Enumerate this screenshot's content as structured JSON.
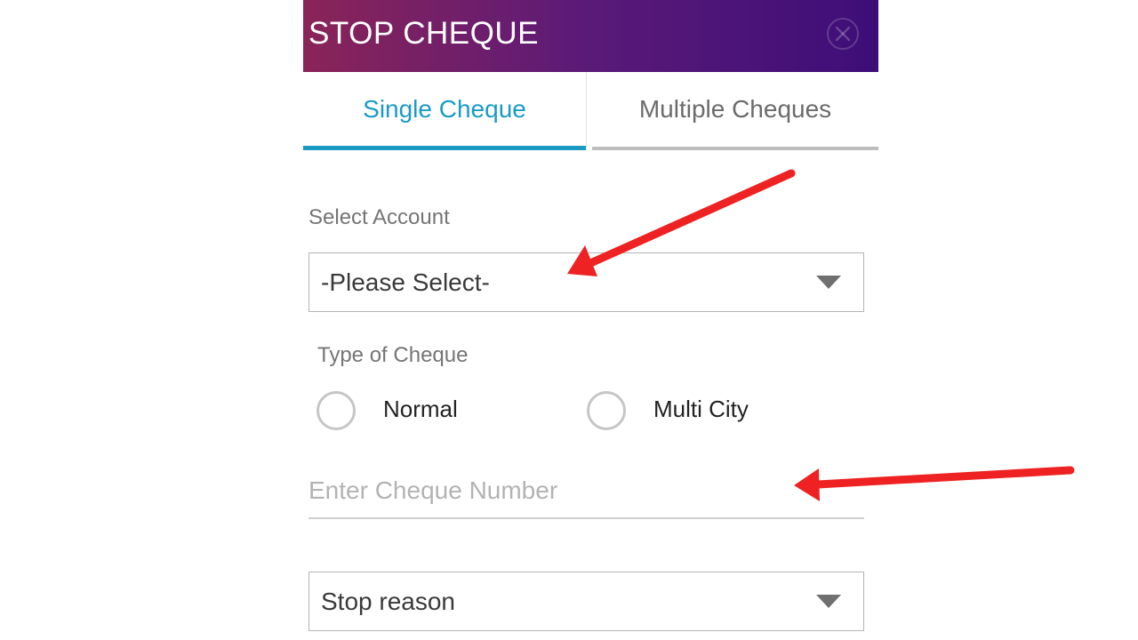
{
  "header": {
    "title": "STOP CHEQUE",
    "close_icon": "close-circle-icon",
    "gradient": [
      "#8a2458",
      "#3d0e78"
    ]
  },
  "tabs": [
    {
      "label": "Single Cheque",
      "active": true
    },
    {
      "label": "Multiple Cheques",
      "active": false
    }
  ],
  "form": {
    "account_label": "Select Account",
    "account_select_value": "-Please Select-",
    "type_label": "Type of Cheque",
    "type_options": [
      {
        "label": "Normal",
        "selected": false
      },
      {
        "label": "Multi City",
        "selected": false
      }
    ],
    "cheque_number_placeholder": "Enter Cheque Number",
    "stop_reason_value": "Stop reason"
  },
  "colors": {
    "accent": "#1a9bc4",
    "annotation_arrow": "#ee2222"
  }
}
